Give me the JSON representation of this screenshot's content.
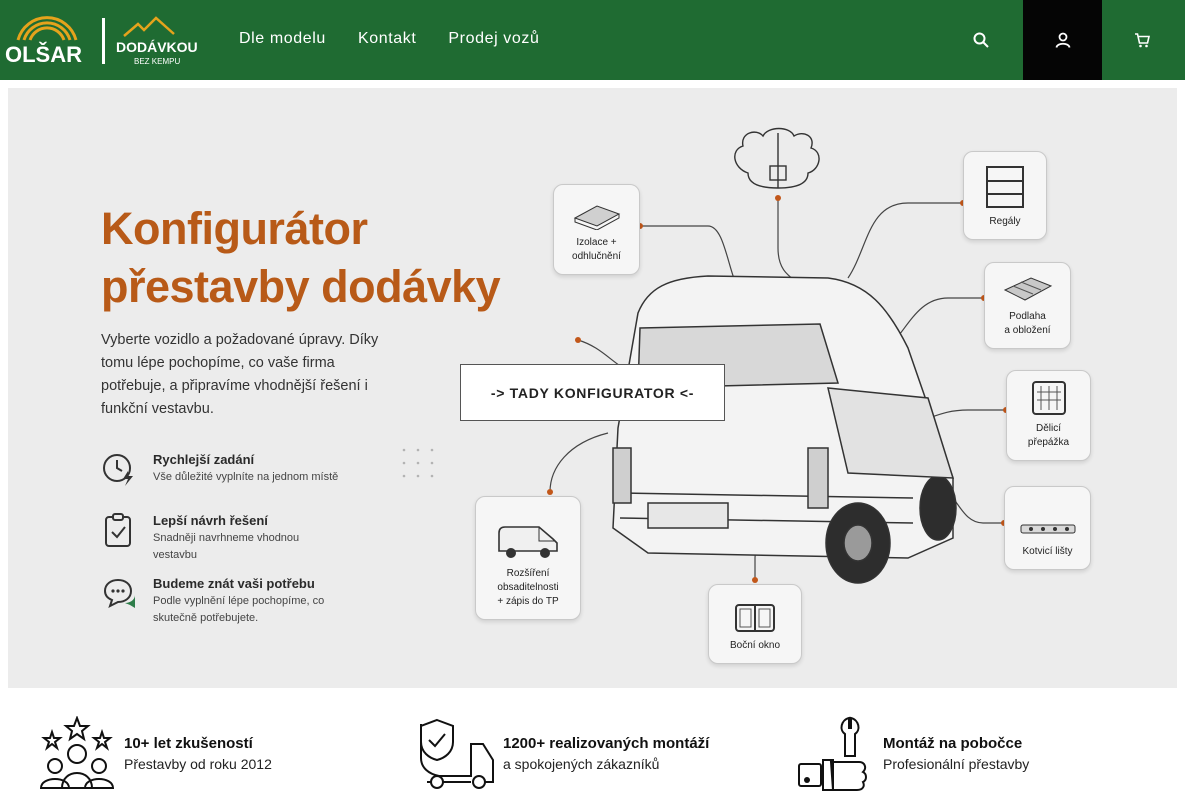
{
  "brand": {
    "name": "OLŠAR",
    "sub_name": "DODÁVKOU",
    "tagline": "BEZ KEMPU",
    "header_color": "#1f6b32",
    "accent_color": "#b85a18"
  },
  "nav": {
    "items": [
      {
        "label": "Dle modelu"
      },
      {
        "label": "Kontakt"
      },
      {
        "label": "Prodej vozů"
      }
    ]
  },
  "header_icons": [
    "search-icon",
    "user-icon",
    "cart-icon"
  ],
  "hero": {
    "title_line1": "Konfigurátor",
    "title_line2": "přestavby dodávky",
    "description": "Vyberte vozidlo a požadované úpravy. Díky tomu lépe pochopíme, co vaše firma potřebuje, a připravíme vhodnější řešení i funkční vestavbu.",
    "features": [
      {
        "icon": "clock-bolt-icon",
        "title": "Rychlejší zadání",
        "subtitle": "Vše důležité vyplníte na jednom místě"
      },
      {
        "icon": "clipboard-check-icon",
        "title": "Lepší návrh řešení",
        "subtitle": "Snadněji navrhneme vhodnou vestavbu"
      },
      {
        "icon": "chat-bubbles-icon",
        "title": "Budeme znát vaši potřebu",
        "subtitle": "Podle vyplnění lépe pochopíme, co skutečně potřebujete."
      }
    ],
    "cards": [
      {
        "key": "insulation",
        "label1": "Izolace +",
        "label2": "odhlučnění"
      },
      {
        "key": "shelves",
        "label1": "Regály",
        "label2": ""
      },
      {
        "key": "floor",
        "label1": "Podlaha",
        "label2": "a obložení"
      },
      {
        "key": "partition",
        "label1": "Dělicí",
        "label2": "přepážka"
      },
      {
        "key": "rails",
        "label1": "Kotvicí lišty",
        "label2": ""
      },
      {
        "key": "seats",
        "label1": "Rozšíření",
        "label2": "obsaditelnosti",
        "label3": "+ zápis do TP"
      },
      {
        "key": "window",
        "label1": "Boční okno",
        "label2": ""
      }
    ],
    "cta_label": "-> TADY KONFIGURATOR <-"
  },
  "usps": [
    {
      "icon": "stars-people-icon",
      "title": "10+ let zkušeností",
      "subtitle": "Přestavby od roku 2012"
    },
    {
      "icon": "truck-shield-icon",
      "title": "1200+ realizovaných montáží",
      "subtitle": "a spokojených zákazníků"
    },
    {
      "icon": "wrench-thumb-icon",
      "title": "Montáž na pobočce",
      "subtitle": "Profesionální přestavby"
    }
  ]
}
